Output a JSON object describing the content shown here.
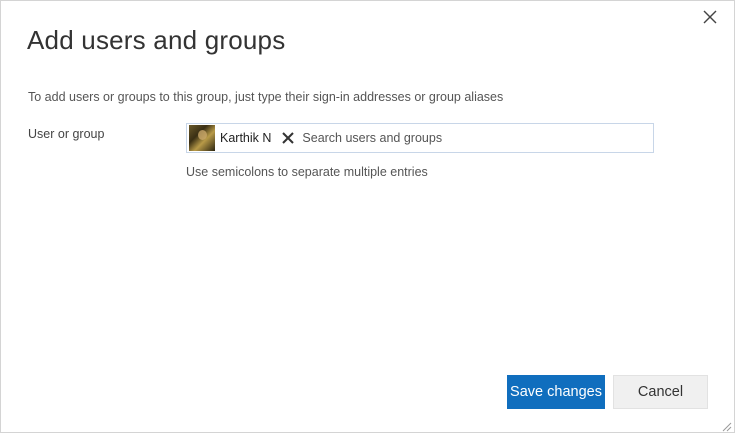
{
  "dialog": {
    "title": "Add users and groups",
    "description": "To add users or groups to this group, just type their sign-in addresses or group aliases",
    "close_icon": "close-icon"
  },
  "form": {
    "field_label": "User or group",
    "selected": [
      {
        "name": "Karthik N",
        "avatar_icon": "user-avatar",
        "remove_icon": "remove-icon"
      }
    ],
    "search_placeholder": "Search users and groups",
    "search_value": "",
    "hint": "Use semicolons to separate multiple entries"
  },
  "actions": {
    "save_label": "Save changes",
    "cancel_label": "Cancel"
  },
  "colors": {
    "primary": "#106ebe",
    "secondary_bg": "#f0f0f0",
    "input_border": "#c8d6e8"
  }
}
